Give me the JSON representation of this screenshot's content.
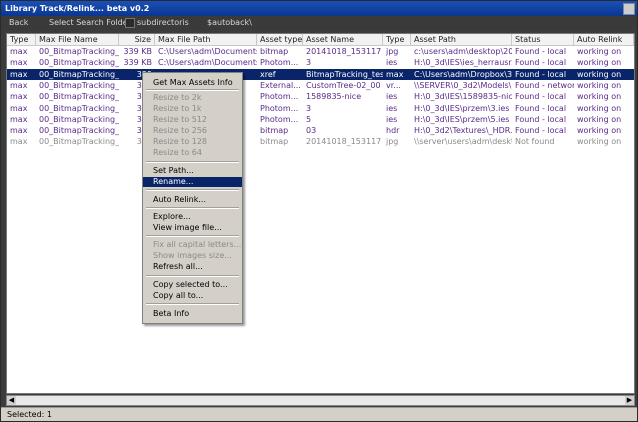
{
  "window": {
    "title": "Library Track/Relink... beta v0.2"
  },
  "toolbar": {
    "back_label": "Back",
    "select_folder_label": "Select Search Folder",
    "subdirs_label": "subdirectoris",
    "autoback_label": "$autoback\\"
  },
  "table": {
    "columns": [
      "Type",
      "Max File Name",
      "Size",
      "Max File Path",
      "Asset type",
      "Asset Name",
      "Type",
      "Asset Path",
      "Status",
      "Auto Relink"
    ],
    "rows": [
      {
        "type": "max",
        "maxfile": "00_BitmapTracking_...",
        "size": "339 KB",
        "maxpath": "C:\\Users\\adm\\Documents...",
        "atype": "bitmap",
        "aname": "20141018_153117",
        "ext": "jpg",
        "apath": "c:\\users\\adm\\desktop\\20...",
        "status": "Found - local",
        "relink": "working on"
      },
      {
        "type": "max",
        "maxfile": "00_BitmapTracking_...",
        "size": "339 KB",
        "maxpath": "C:\\Users\\adm\\Documents...",
        "atype": "Photom...",
        "aname": "3",
        "ext": "ies",
        "apath": "H:\\0_3d\\IES\\ies_herrausr...",
        "status": "Found - local",
        "relink": "working on"
      },
      {
        "type": "max",
        "maxfile": "00_BitmapTracking_...",
        "size": "339",
        "maxpath": "",
        "atype": "xref",
        "aname": "BitmapTracking_tes...",
        "ext": "max",
        "apath": "C:\\Users\\adm\\Dropbox\\3...",
        "status": "Found - local",
        "relink": "working on"
      },
      {
        "type": "max",
        "maxfile": "00_BitmapTracking_...",
        "size": "339",
        "maxpath": "",
        "atype": "External...",
        "aname": "CustomTree-02_00",
        "ext": "vr...",
        "apath": "\\\\SERVER\\0_3d2\\Models\\...",
        "status": "Found - network",
        "relink": "working on"
      },
      {
        "type": "max",
        "maxfile": "00_BitmapTracking_...",
        "size": "339",
        "maxpath": "",
        "atype": "Photom...",
        "aname": "1589835-nice",
        "ext": "ies",
        "apath": "H:\\0_3d\\IES\\1589835-nic...",
        "status": "Found - local",
        "relink": "working on"
      },
      {
        "type": "max",
        "maxfile": "00_BitmapTracking_...",
        "size": "339",
        "maxpath": "",
        "atype": "Photom...",
        "aname": "3",
        "ext": "ies",
        "apath": "H:\\0_3d\\IES\\przem\\3.ies",
        "status": "Found - local",
        "relink": "working on"
      },
      {
        "type": "max",
        "maxfile": "00_BitmapTracking_...",
        "size": "339",
        "maxpath": "",
        "atype": "Photom...",
        "aname": "5",
        "ext": "ies",
        "apath": "H:\\0_3d\\IES\\przem\\5.ies",
        "status": "Found - local",
        "relink": "working on"
      },
      {
        "type": "max",
        "maxfile": "00_BitmapTracking_...",
        "size": "339",
        "maxpath": "",
        "atype": "bitmap",
        "aname": "03",
        "ext": "hdr",
        "apath": "H:\\0_3d2\\Textures\\_HDR...",
        "status": "Found - local",
        "relink": "working on"
      },
      {
        "type": "max",
        "maxfile": "00_BitmapTracking_...",
        "size": "339",
        "maxpath": "",
        "atype": "bitmap",
        "aname": "20141018_153117",
        "ext": "jpg",
        "apath": "\\\\server\\users\\adm\\deskt...",
        "status": "Not found",
        "relink": "working on"
      }
    ]
  },
  "context_menu": {
    "items": [
      {
        "label": "Get Max Assets Info",
        "enabled": true
      },
      {
        "label": "Resize to 2k",
        "enabled": false
      },
      {
        "label": "Resize to 1k",
        "enabled": false
      },
      {
        "label": "Resize to 512",
        "enabled": false
      },
      {
        "label": "Resize to 256",
        "enabled": false
      },
      {
        "label": "Resize to 128",
        "enabled": false
      },
      {
        "label": "Resize to 64",
        "enabled": false
      },
      {
        "label": "Set Path...",
        "enabled": true
      },
      {
        "label": "Rename...",
        "enabled": true,
        "highlighted": true
      },
      {
        "label": "Auto Relink...",
        "enabled": true
      },
      {
        "label": "Explore...",
        "enabled": true
      },
      {
        "label": "View image file...",
        "enabled": true
      },
      {
        "label": "Fix all capital letters...",
        "enabled": false
      },
      {
        "label": "Show images size...",
        "enabled": false
      },
      {
        "label": "Refresh all...",
        "enabled": true
      },
      {
        "label": "Copy selected to...",
        "enabled": true
      },
      {
        "label": "Copy all to...",
        "enabled": true
      },
      {
        "label": "Beta Info",
        "enabled": true
      }
    ]
  },
  "status": {
    "text": "Selected: 1"
  },
  "colors": {
    "title_bar": "#0a3690",
    "selection": "#0a246a",
    "row_text": "#5a2a8a",
    "disabled_text": "#8a8a8a"
  }
}
